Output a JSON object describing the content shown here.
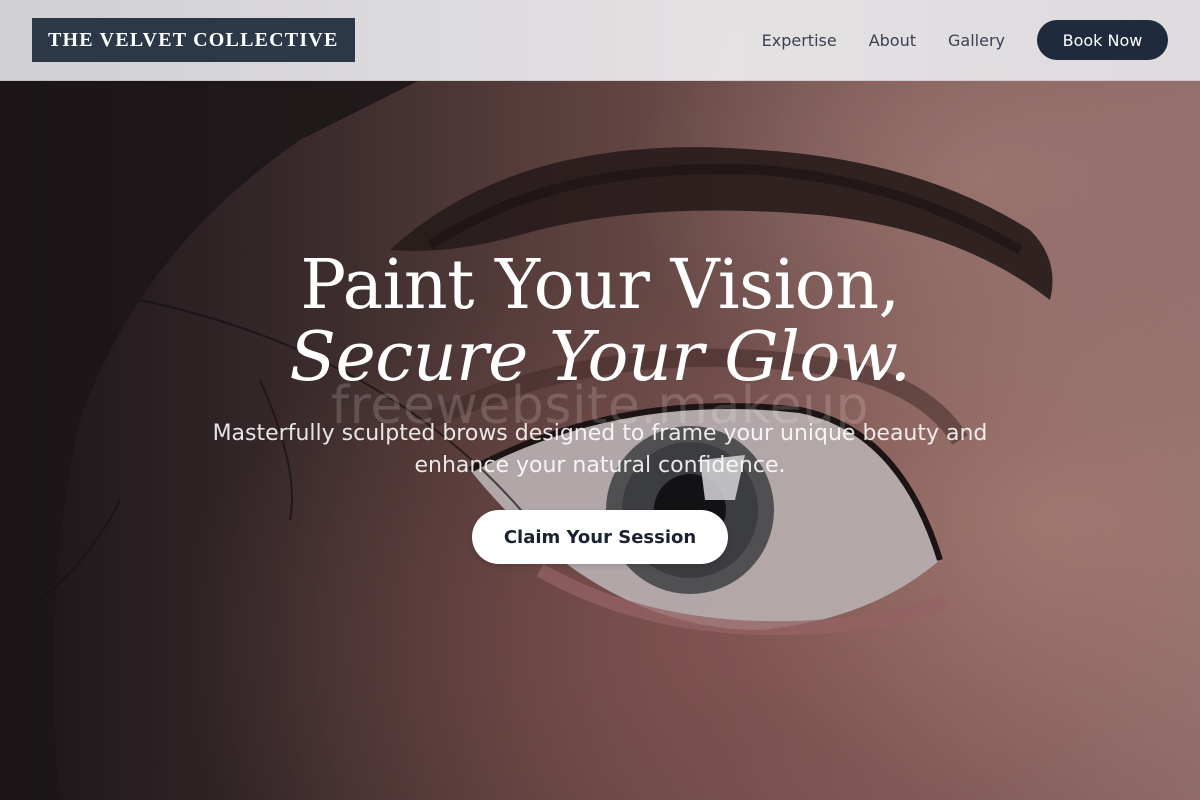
{
  "header": {
    "logo": "THE VELVET COLLECTIVE",
    "nav": [
      {
        "label": "Expertise"
      },
      {
        "label": "About"
      },
      {
        "label": "Gallery"
      }
    ],
    "cta_label": "Book Now"
  },
  "hero": {
    "headline_line1": "Paint Your Vision,",
    "headline_line2": "Secure Your Glow.",
    "watermark": "freewebsite.makeup",
    "subheading": "Masterfully sculpted brows designed to frame your unique beauty and enhance your natural confidence.",
    "cta_label": "Claim Your Session"
  },
  "colors": {
    "brand_dark": "#2c3848",
    "button_dark": "#1f2a3c",
    "text_light": "#ffffff"
  }
}
